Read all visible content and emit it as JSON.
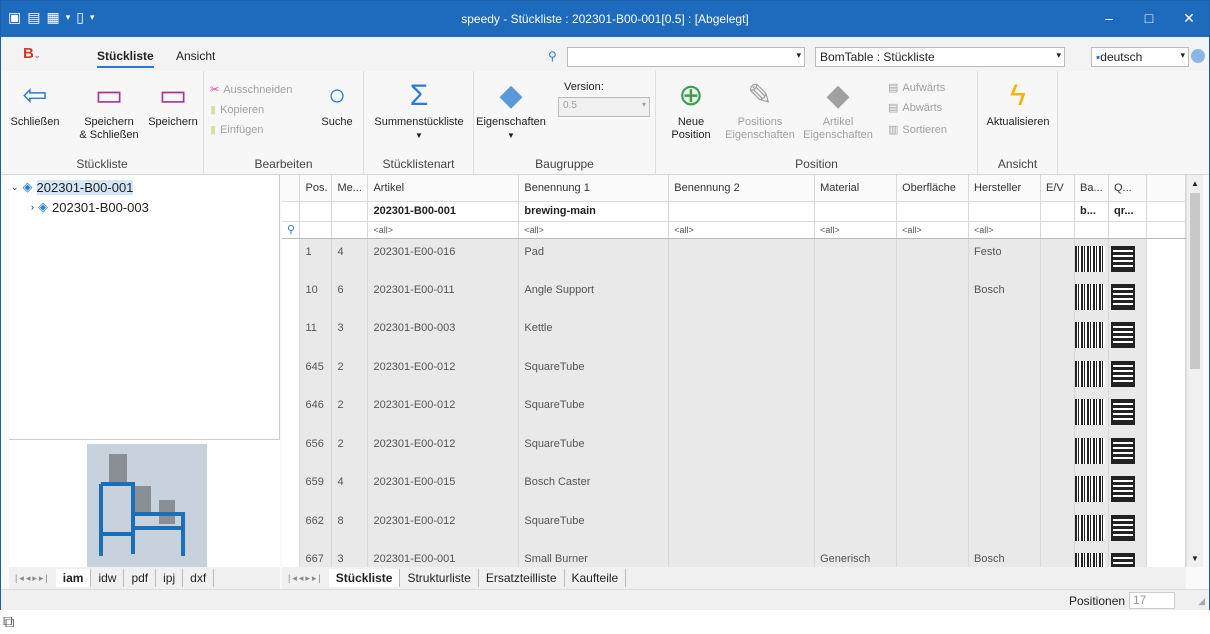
{
  "window": {
    "title": "speedy -  Stückliste : 202301-B00-001[0.5] : [Abgelegt]"
  },
  "ribbon_tabs": [
    "Stückliste",
    "Ansicht"
  ],
  "search": {
    "value": ""
  },
  "bomtable": {
    "value": "BomTable : Stückliste"
  },
  "language": {
    "value": "deutsch"
  },
  "groups": {
    "stueckliste": {
      "label": "Stückliste",
      "close": "Schließen",
      "save_close": "Speichern\n& Schließen",
      "save": "Speichern"
    },
    "bearbeiten": {
      "label": "Bearbeiten",
      "cut": "Ausschneiden",
      "copy": "Kopieren",
      "paste": "Einfügen",
      "search": "Suche"
    },
    "stuecklistenart": {
      "label": "Stücklistenart",
      "sum": "Summenstückliste"
    },
    "baugruppe": {
      "label": "Baugruppe",
      "props": "Eigenschaften",
      "version_label": "Version:",
      "version_value": "0.5"
    },
    "position": {
      "label": "Position",
      "new": "Neue\nPosition",
      "pos_props": "Positions\nEigenschaften",
      "art_props": "Artikel\nEigenschaften",
      "up": "Aufwärts",
      "down": "Abwärts",
      "sort": "Sortieren"
    },
    "ansicht": {
      "label": "Ansicht",
      "refresh": "Aktualisieren"
    }
  },
  "tree": {
    "root": "202301-B00-001",
    "child": "202301-B00-003"
  },
  "preview_tabs": [
    "iam",
    "idw",
    "pdf",
    "ipj",
    "dxf"
  ],
  "grid": {
    "columns": [
      "Pos.",
      "Me...",
      "Artikel",
      "Benennung 1",
      "Benennung 2",
      "Material",
      "Oberfläche",
      "Hersteller",
      "E/V",
      "Ba...",
      "Q..."
    ],
    "summary": {
      "artikel": "202301-B00-001",
      "benennung1": "brewing-main",
      "ba": "b...",
      "q": "qr..."
    },
    "filter": "<all>",
    "rows": [
      {
        "pos": "1",
        "menge": "4",
        "artikel": "202301-E00-016",
        "ben1": "Pad",
        "material": "",
        "hersteller": "Festo"
      },
      {
        "pos": "10",
        "menge": "6",
        "artikel": "202301-E00-011",
        "ben1": "Angle Support",
        "material": "",
        "hersteller": "Bosch"
      },
      {
        "pos": "11",
        "menge": "3",
        "artikel": "202301-B00-003",
        "ben1": "Kettle",
        "material": "",
        "hersteller": ""
      },
      {
        "pos": "645",
        "menge": "2",
        "artikel": "202301-E00-012",
        "ben1": "SquareTube",
        "material": "",
        "hersteller": ""
      },
      {
        "pos": "646",
        "menge": "2",
        "artikel": "202301-E00-012",
        "ben1": "SquareTube",
        "material": "",
        "hersteller": ""
      },
      {
        "pos": "656",
        "menge": "2",
        "artikel": "202301-E00-012",
        "ben1": "SquareTube",
        "material": "",
        "hersteller": ""
      },
      {
        "pos": "659",
        "menge": "4",
        "artikel": "202301-E00-015",
        "ben1": "Bosch Caster",
        "material": "",
        "hersteller": ""
      },
      {
        "pos": "662",
        "menge": "8",
        "artikel": "202301-E00-012",
        "ben1": "SquareTube",
        "material": "",
        "hersteller": ""
      },
      {
        "pos": "667",
        "menge": "3",
        "artikel": "202301-E00-001",
        "ben1": "Small Burner",
        "material": "Generisch",
        "hersteller": "Bosch"
      }
    ]
  },
  "grid_tabs": [
    "Stückliste",
    "Strukturliste",
    "Ersatzteilliste",
    "Kaufteile"
  ],
  "status": {
    "label": "Positionen",
    "count": "17"
  },
  "colors": {
    "titlebar": "#1e6bbd",
    "accent": "#2b7bd4"
  }
}
